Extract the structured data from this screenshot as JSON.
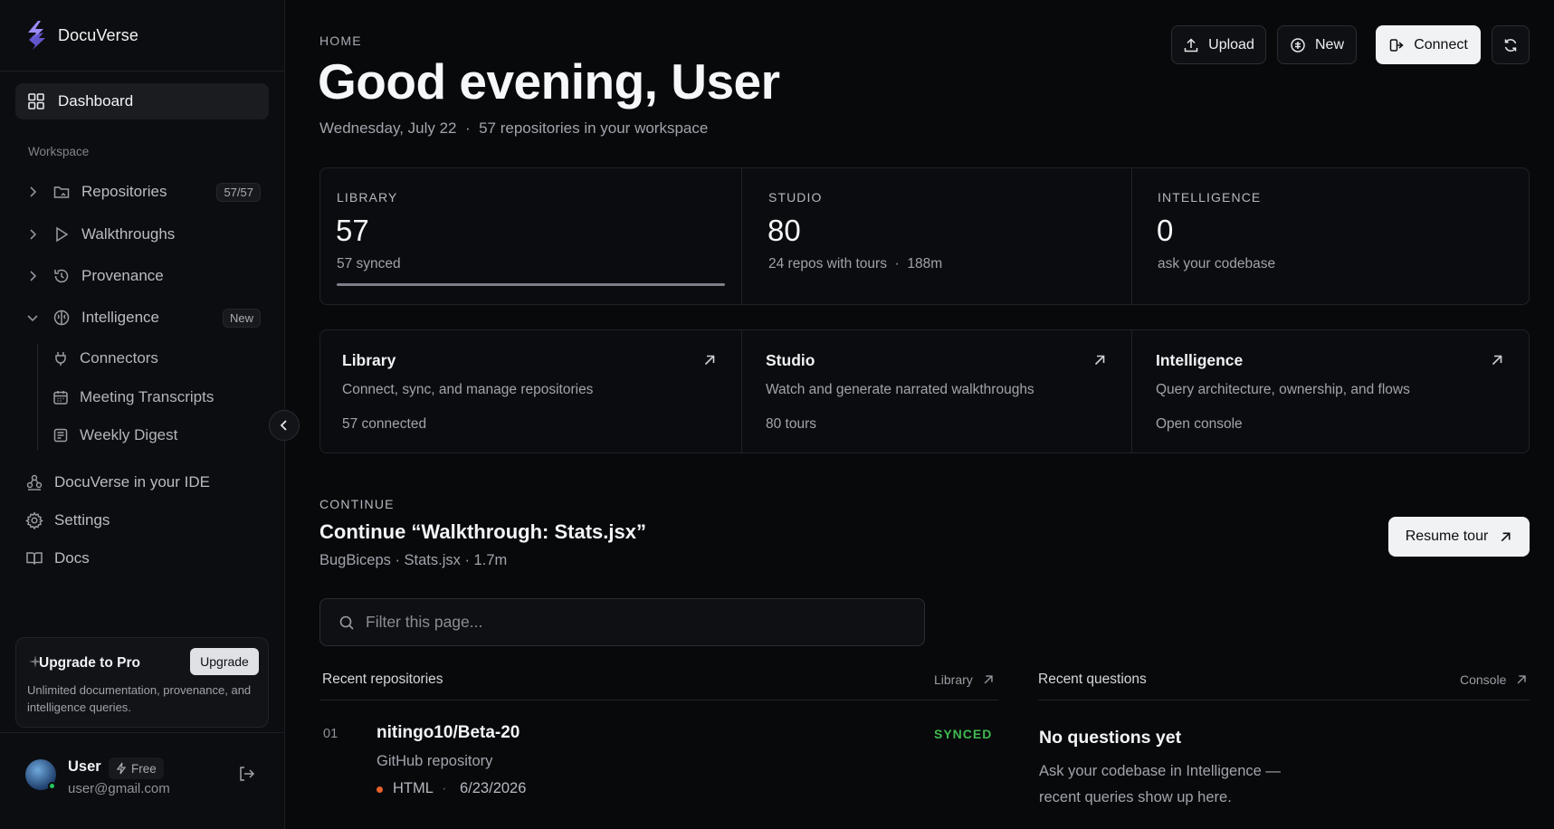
{
  "app": {
    "name": "DocuVerse"
  },
  "sidebar": {
    "dashboard_label": "Dashboard",
    "workspace_label": "Workspace",
    "items": [
      {
        "label": "Repositories",
        "badge": "57/57",
        "icon": "folder-icon",
        "expanded": false
      },
      {
        "label": "Walkthroughs",
        "icon": "play-icon",
        "expanded": false
      },
      {
        "label": "Provenance",
        "icon": "history-icon",
        "expanded": false
      },
      {
        "label": "Intelligence",
        "badge": "New",
        "icon": "brain-icon",
        "expanded": true
      }
    ],
    "sub_items": [
      {
        "label": "Connectors",
        "icon": "plug-icon"
      },
      {
        "label": "Meeting Transcripts",
        "icon": "calendar-icon"
      },
      {
        "label": "Weekly Digest",
        "icon": "newspaper-icon"
      }
    ],
    "bottom_items": [
      {
        "label": "DocuVerse in your IDE",
        "icon": "ide-icon"
      },
      {
        "label": "Settings",
        "icon": "gear-icon"
      },
      {
        "label": "Docs",
        "icon": "book-icon"
      }
    ],
    "upgrade": {
      "title": "Upgrade to Pro",
      "button": "Upgrade",
      "description": "Unlimited documentation, provenance, and intelligence queries."
    },
    "user": {
      "name": "User",
      "plan": "Free",
      "email": "user@gmail.com"
    }
  },
  "header": {
    "breadcrumb": "HOME",
    "greeting": "Good evening, User",
    "date": "Wednesday, July 22",
    "separator": "·",
    "workspace_summary": "57 repositories in your workspace",
    "buttons": {
      "upload": "Upload",
      "new": "New",
      "connect": "Connect"
    }
  },
  "stats": [
    {
      "label": "LIBRARY",
      "value": "57",
      "sub": "57 synced",
      "progress": 1.0
    },
    {
      "label": "STUDIO",
      "value": "80",
      "sub": "24 repos with tours",
      "sub2": "188m"
    },
    {
      "label": "INTELLIGENCE",
      "value": "0",
      "sub": "ask your codebase"
    }
  ],
  "cards": [
    {
      "title": "Library",
      "description": "Connect, sync, and manage repositories",
      "meta": "57 connected"
    },
    {
      "title": "Studio",
      "description": "Watch and generate narrated walkthroughs",
      "meta": "80 tours"
    },
    {
      "title": "Intelligence",
      "description": "Query architecture, ownership, and flows",
      "meta": "Open console"
    }
  ],
  "continue": {
    "label": "CONTINUE",
    "title": "Continue “Walkthrough: Stats.jsx”",
    "meta": "BugBiceps · Stats.jsx · 1.7m",
    "button": "Resume tour"
  },
  "filter": {
    "placeholder": "Filter this page..."
  },
  "recent_repos": {
    "heading": "Recent repositories",
    "link": "Library",
    "rows": [
      {
        "index": "01",
        "name": "nitingo10/Beta-20",
        "type": "GitHub repository",
        "language": "HTML",
        "date": "6/23/2026",
        "status": "SYNCED",
        "language_color": "#e8622c"
      }
    ]
  },
  "recent_questions": {
    "heading": "Recent questions",
    "link": "Console",
    "empty_title": "No questions yet",
    "empty_desc": "Ask your codebase in Intelligence — recent queries show up here."
  },
  "colors": {
    "background": "#08090b",
    "sidebar": "#0c0d10",
    "accent": "#8b7cf6",
    "synced": "#3fb950"
  }
}
